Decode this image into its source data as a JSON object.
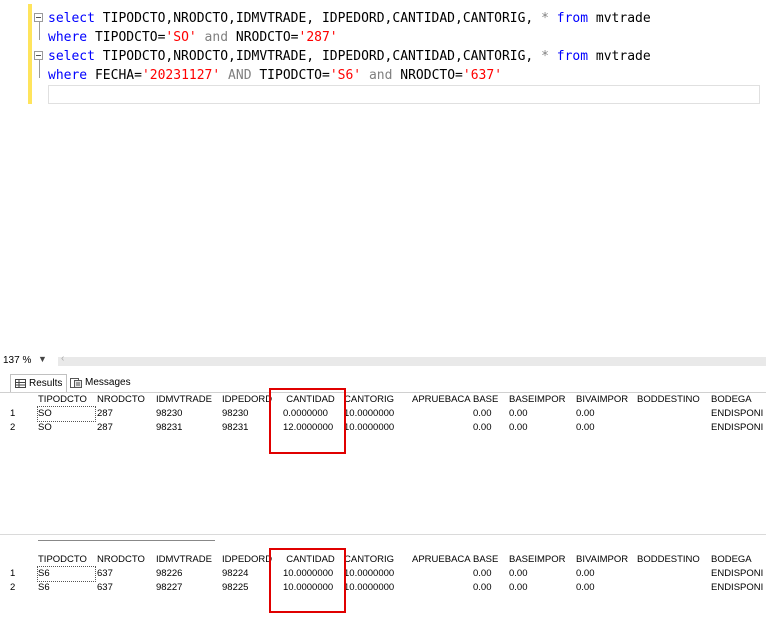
{
  "editor": {
    "line1": {
      "kw1": "select",
      "cols": " TIPODCTO,NRODCTO,IDMVTRADE, IDPEDORD,CANTIDAD,CANTORIG,",
      "star": " * ",
      "kw2": "from",
      "table": " mvtrade"
    },
    "line2": {
      "kw1": "where",
      "p1": " TIPODCTO=",
      "v1": "'SO'",
      "and": " and ",
      "p2": "NRODCTO=",
      "v2": "'287'"
    },
    "line3": {
      "kw1": "select",
      "cols": " TIPODCTO,NRODCTO,IDMVTRADE, IDPEDORD,CANTIDAD,CANTORIG,",
      "star": " * ",
      "kw2": "from",
      "table": " mvtrade"
    },
    "line4": {
      "kw1": "where",
      "p1": " FECHA=",
      "v1": "'20231127'",
      "and1": " AND ",
      "p2": "TIPODCTO=",
      "v2": "'S6'",
      "and2": " and ",
      "p3": "NRODCTO=",
      "v3": "'637'"
    }
  },
  "zoom": {
    "value": "137 %",
    "dropdown_icon": "chevron-down"
  },
  "tabs": {
    "results": "Results",
    "messages": "Messages"
  },
  "columns": [
    "TIPODCTO",
    "NRODCTO",
    "IDMVTRADE",
    "IDPEDORD",
    "CANTIDAD",
    "CANTORIG",
    "APRUEBACAL",
    "BASE",
    "BASEIMPOR",
    "BIVAIMPOR",
    "BODDESTINO",
    "BODEGA"
  ],
  "grid1": {
    "rows": [
      {
        "num": "1",
        "TIPODCTO": "SO",
        "NRODCTO": "287",
        "IDMVTRADE": "98230",
        "IDPEDORD": "98230",
        "CANTIDAD": "0.0000000",
        "CANTORIG": "10.0000000",
        "APRUEBACAL": "",
        "BASE": "0.00",
        "BASEIMPOR": "0.00",
        "BIVAIMPOR": "0.00",
        "BODDESTINO": "",
        "BODEGA": "ENDISPONIE"
      },
      {
        "num": "2",
        "TIPODCTO": "SO",
        "NRODCTO": "287",
        "IDMVTRADE": "98231",
        "IDPEDORD": "98231",
        "CANTIDAD": "12.0000000",
        "CANTORIG": "10.0000000",
        "APRUEBACAL": "",
        "BASE": "0.00",
        "BASEIMPOR": "0.00",
        "BIVAIMPOR": "0.00",
        "BODDESTINO": "",
        "BODEGA": "ENDISPONIE"
      }
    ]
  },
  "grid2": {
    "rows": [
      {
        "num": "1",
        "TIPODCTO": "S6",
        "NRODCTO": "637",
        "IDMVTRADE": "98226",
        "IDPEDORD": "98224",
        "CANTIDAD": "10.0000000",
        "CANTORIG": "10.0000000",
        "APRUEBACAL": "",
        "BASE": "0.00",
        "BASEIMPOR": "0.00",
        "BIVAIMPOR": "0.00",
        "BODDESTINO": "",
        "BODEGA": "ENDISPONIE"
      },
      {
        "num": "2",
        "TIPODCTO": "S6",
        "NRODCTO": "637",
        "IDMVTRADE": "98227",
        "IDPEDORD": "98225",
        "CANTIDAD": "10.0000000",
        "CANTORIG": "10.0000000",
        "APRUEBACAL": "",
        "BASE": "0.00",
        "BASEIMPOR": "0.00",
        "BIVAIMPOR": "0.00",
        "BODDESTINO": "",
        "BODEGA": "ENDISPONIE"
      }
    ]
  },
  "highlight_color": "#e00000"
}
